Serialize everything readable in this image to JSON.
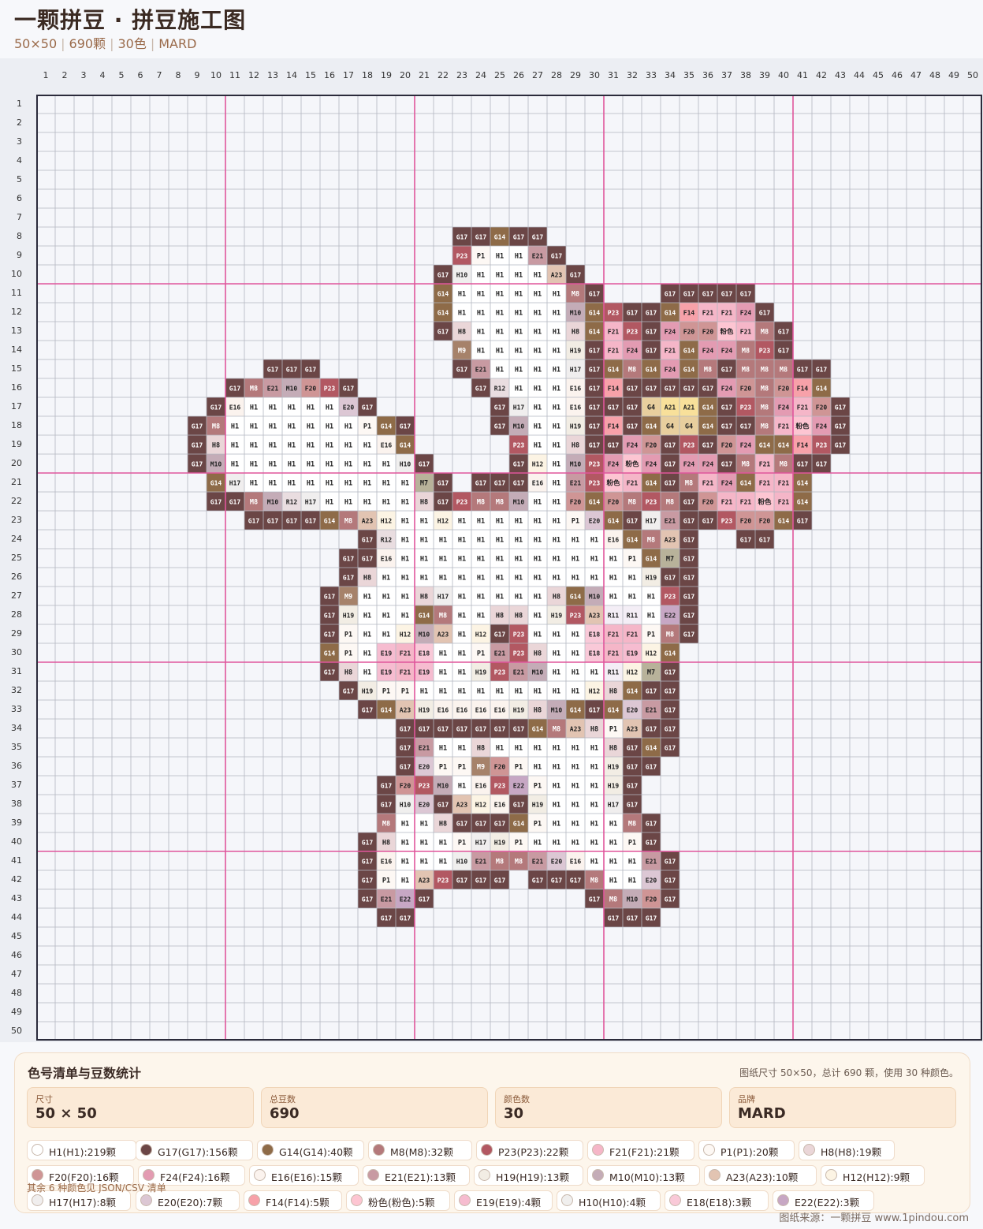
{
  "header": {
    "title": "一颗拼豆 · 拼豆施工图",
    "size": "50×50",
    "count": "690颗",
    "colors": "30色",
    "brand": "MARD"
  },
  "grid": {
    "cols": 50,
    "rows": 50,
    "major_every": 10,
    "line_color": "#b3b7c0",
    "major_color": "#e0569c",
    "border_color": "#2b2b3b",
    "background": "#f5f6fa"
  },
  "palette": {
    "G17": "#6b4646",
    "G14": "#8e6b48",
    "H1": "#ffffff",
    "P23": "#b25862",
    "P1": "#fdf8f4",
    "E21": "#c89aa2",
    "H10": "#f0efee",
    "A23": "#e2c4b2",
    "M8": "#b4797b",
    "M10": "#c4acb7",
    "H8": "#ead6d8",
    "H19": "#f2ede4",
    "M9": "#a6826a",
    "H17": "#f0eeee",
    "R12": "#e9dde0",
    "E16": "#fbf3ee",
    "E20": "#dcc7d4",
    "F20": "#cf9595",
    "F14": "#f7a1a9",
    "F21": "#f5b6c8",
    "F24": "#e39bb2",
    "G4": "#e8cf9e",
    "A21": "#f8e09a",
    "粉色": "#fdc5d2",
    "M7": "#b8b29a",
    "H12": "#fcf4e4",
    "E18": "#f9c9d8",
    "R11": "#f4eef6",
    "E19": "#f6bcd0",
    "E22": "#c7a7c4"
  },
  "rows_data": [
    {
      "r": 8,
      "c": 23,
      "codes": [
        "G17",
        "G17",
        "G14",
        "G17",
        "G17"
      ]
    },
    {
      "r": 9,
      "c": 23,
      "codes": [
        "P23",
        "P1",
        "H1",
        "H1",
        "E21",
        "G17"
      ]
    },
    {
      "r": 10,
      "c": 22,
      "codes": [
        "G17",
        "H10",
        "H1",
        "H1",
        "H1",
        "H1",
        "A23",
        "G17"
      ]
    },
    {
      "r": 11,
      "c": 22,
      "codes": [
        "G14",
        "H1",
        "H1",
        "H1",
        "H1",
        "H1",
        "H1",
        "M8",
        "G17"
      ]
    },
    {
      "r": 11,
      "c": 34,
      "codes": [
        "G17",
        "G17",
        "G17",
        "G17",
        "G17"
      ]
    },
    {
      "r": 12,
      "c": 22,
      "codes": [
        "G14",
        "H1",
        "H1",
        "H1",
        "H1",
        "H1",
        "H1",
        "M10",
        "G14",
        "P23",
        "G17",
        "G17",
        "G14",
        "F14",
        "F21",
        "F21",
        "F24",
        "G17"
      ]
    },
    {
      "r": 13,
      "c": 22,
      "codes": [
        "G17",
        "H8",
        "H1",
        "H1",
        "H1",
        "H1",
        "H1",
        "H8",
        "G14",
        "F21",
        "P23",
        "G17",
        "F24",
        "F20",
        "F20",
        "粉色",
        "F21",
        "M8",
        "G17"
      ]
    },
    {
      "r": 14,
      "c": 23,
      "codes": [
        "M9",
        "H1",
        "H1",
        "H1",
        "H1",
        "H1",
        "H19",
        "G17",
        "F21",
        "F24",
        "G17",
        "F21",
        "G14",
        "F24",
        "F24",
        "M8",
        "P23",
        "G17"
      ]
    },
    {
      "r": 15,
      "c": 13,
      "codes": [
        "G17",
        "G17",
        "G17"
      ]
    },
    {
      "r": 15,
      "c": 23,
      "codes": [
        "G17",
        "E21",
        "H1",
        "H1",
        "H1",
        "H1",
        "H17",
        "G17",
        "G14",
        "M8",
        "G14",
        "F24",
        "G14",
        "M8",
        "G17",
        "M8",
        "M8",
        "M8",
        "G17",
        "G17"
      ]
    },
    {
      "r": 16,
      "c": 11,
      "codes": [
        "G17",
        "M8",
        "E21",
        "M10",
        "F20",
        "P23",
        "G17"
      ]
    },
    {
      "r": 16,
      "c": 24,
      "codes": [
        "G17",
        "R12",
        "H1",
        "H1",
        "H1",
        "E16",
        "G17",
        "F14",
        "G17",
        "G17",
        "G17",
        "G17",
        "G17",
        "F24",
        "F20",
        "M8",
        "F20",
        "F14",
        "G14"
      ]
    },
    {
      "r": 17,
      "c": 10,
      "codes": [
        "G17",
        "E16",
        "H1",
        "H1",
        "H1",
        "H1",
        "H1",
        "E20",
        "G17"
      ]
    },
    {
      "r": 17,
      "c": 25,
      "codes": [
        "G17",
        "H17",
        "H1",
        "H1",
        "E16",
        "G17",
        "G17",
        "G17",
        "G4",
        "A21",
        "A21",
        "G14",
        "G17",
        "P23",
        "M8",
        "F24",
        "F21",
        "F20",
        "G17"
      ]
    },
    {
      "r": 18,
      "c": 9,
      "codes": [
        "G17",
        "M8",
        "H1",
        "H1",
        "H1",
        "H1",
        "H1",
        "H1",
        "H1",
        "P1",
        "G14",
        "G17"
      ]
    },
    {
      "r": 18,
      "c": 25,
      "codes": [
        "G17",
        "M10",
        "H1",
        "H1",
        "H19",
        "G17",
        "F14",
        "G17",
        "G14",
        "G4",
        "G4",
        "G14",
        "G17",
        "G17",
        "M8",
        "F21",
        "粉色",
        "F24",
        "G17"
      ]
    },
    {
      "r": 19,
      "c": 9,
      "codes": [
        "G17",
        "H8",
        "H1",
        "H1",
        "H1",
        "H1",
        "H1",
        "H1",
        "H1",
        "H1",
        "E16",
        "G14"
      ]
    },
    {
      "r": 19,
      "c": 26,
      "codes": [
        "P23",
        "H1",
        "H1",
        "H8",
        "G17",
        "G17",
        "F24",
        "F20",
        "G17",
        "P23",
        "G17",
        "F20",
        "F24",
        "G14",
        "G14",
        "F14",
        "P23",
        "G17"
      ]
    },
    {
      "r": 20,
      "c": 9,
      "codes": [
        "G17",
        "M10",
        "H1",
        "H1",
        "H1",
        "H1",
        "H1",
        "H1",
        "H1",
        "H1",
        "H1",
        "H10",
        "G17"
      ]
    },
    {
      "r": 20,
      "c": 26,
      "codes": [
        "G17",
        "H12",
        "H1",
        "M10",
        "P23",
        "F24",
        "粉色",
        "F24",
        "G17",
        "F24",
        "F24",
        "G17",
        "M8",
        "F21",
        "M8",
        "G17",
        "G17"
      ]
    },
    {
      "r": 21,
      "c": 10,
      "codes": [
        "G14",
        "H17",
        "H1",
        "H1",
        "H1",
        "H1",
        "H1",
        "H1",
        "H1",
        "H1",
        "H1",
        "M7",
        "G17"
      ]
    },
    {
      "r": 21,
      "c": 24,
      "codes": [
        "G17",
        "G17",
        "G17",
        "E16",
        "H1",
        "E21",
        "P23",
        "粉色",
        "F21",
        "G14",
        "G17",
        "M8",
        "F21",
        "F24",
        "G14",
        "F21",
        "F21",
        "G14"
      ]
    },
    {
      "r": 22,
      "c": 10,
      "codes": [
        "G17",
        "G17",
        "M8",
        "M10",
        "R12",
        "H17",
        "H1",
        "H1",
        "H1",
        "H1",
        "H1",
        "H8",
        "G17",
        "P23",
        "M8",
        "M8",
        "M10",
        "H1",
        "H1",
        "F20",
        "G14",
        "F20",
        "M8",
        "P23",
        "M8",
        "G17",
        "F20",
        "F21",
        "F21",
        "粉色",
        "F21",
        "G14"
      ]
    },
    {
      "r": 23,
      "c": 12,
      "codes": [
        "G17",
        "G17",
        "G17",
        "G17",
        "G14",
        "M8",
        "A23",
        "H12",
        "H1",
        "H1",
        "H12",
        "H1",
        "H1",
        "H1",
        "H1",
        "H1",
        "H1",
        "P1",
        "E20",
        "G14",
        "G17",
        "H17",
        "E21",
        "G17",
        "G17",
        "P23",
        "F20",
        "F20",
        "G14",
        "G17"
      ]
    },
    {
      "r": 24,
      "c": 18,
      "codes": [
        "G17",
        "R12",
        "H1",
        "H1",
        "H1",
        "H1",
        "H1",
        "H1",
        "H1",
        "H1",
        "H1",
        "H1",
        "H1",
        "E16",
        "G14",
        "M8",
        "A23",
        "G17"
      ]
    },
    {
      "r": 24,
      "c": 38,
      "codes": [
        "G17",
        "G17"
      ]
    },
    {
      "r": 25,
      "c": 17,
      "codes": [
        "G17",
        "G17",
        "E16",
        "H1",
        "H1",
        "H1",
        "H1",
        "H1",
        "H1",
        "H1",
        "H1",
        "H1",
        "H1",
        "H1",
        "H1",
        "P1",
        "G14",
        "M7",
        "G17"
      ]
    },
    {
      "r": 26,
      "c": 17,
      "codes": [
        "G17",
        "H8",
        "H1",
        "H1",
        "H1",
        "H1",
        "H1",
        "H1",
        "H1",
        "H1",
        "H1",
        "H1",
        "H1",
        "H1",
        "H1",
        "H1",
        "H19",
        "G17",
        "G17"
      ]
    },
    {
      "r": 27,
      "c": 16,
      "codes": [
        "G17",
        "M9",
        "H1",
        "H1",
        "H1",
        "H8",
        "H17",
        "H1",
        "H1",
        "H1",
        "H1",
        "H1",
        "H8",
        "G14",
        "M10",
        "H1",
        "H1",
        "H1",
        "P23",
        "G17"
      ]
    },
    {
      "r": 28,
      "c": 16,
      "codes": [
        "G17",
        "H19",
        "H1",
        "H1",
        "H1",
        "G14",
        "M8",
        "H1",
        "H1",
        "H8",
        "H8",
        "H1",
        "H19",
        "P23",
        "A23",
        "R11",
        "R11",
        "H1",
        "E22",
        "G17"
      ]
    },
    {
      "r": 29,
      "c": 16,
      "codes": [
        "G17",
        "P1",
        "H1",
        "H1",
        "H12",
        "M10",
        "A23",
        "H1",
        "H12",
        "G17",
        "P23",
        "H1",
        "H1",
        "H1",
        "E18",
        "F21",
        "F21",
        "P1",
        "M8",
        "G17"
      ]
    },
    {
      "r": 30,
      "c": 16,
      "codes": [
        "G14",
        "P1",
        "H1",
        "E19",
        "F21",
        "E18",
        "H1",
        "H1",
        "P1",
        "E21",
        "P23",
        "H8",
        "H1",
        "H1",
        "E18",
        "F21",
        "E19",
        "H12",
        "G14"
      ]
    },
    {
      "r": 31,
      "c": 16,
      "codes": [
        "G17",
        "H8",
        "H1",
        "E19",
        "F21",
        "E19",
        "H1",
        "H1",
        "H19",
        "P23",
        "E21",
        "M10",
        "H1",
        "H1",
        "H1",
        "R11",
        "H12",
        "M7",
        "G17"
      ]
    },
    {
      "r": 32,
      "c": 17,
      "codes": [
        "G17",
        "H19",
        "P1",
        "P1",
        "H1",
        "H1",
        "H1",
        "H1",
        "H1",
        "H1",
        "H1",
        "H1",
        "H1",
        "H12",
        "H8",
        "G14",
        "G17",
        "G17"
      ]
    },
    {
      "r": 33,
      "c": 18,
      "codes": [
        "G17",
        "G14",
        "A23",
        "H19",
        "E16",
        "E16",
        "E16",
        "E16",
        "H19",
        "H8",
        "M10",
        "G14",
        "G17",
        "G14",
        "E20",
        "E21",
        "G17"
      ]
    },
    {
      "r": 34,
      "c": 20,
      "codes": [
        "G17",
        "G17",
        "G17",
        "G17",
        "G17",
        "G17",
        "G17",
        "G14",
        "M8",
        "A23",
        "H8",
        "P1",
        "A23",
        "G17",
        "G17"
      ]
    },
    {
      "r": 35,
      "c": 20,
      "codes": [
        "G17",
        "E21",
        "H1",
        "H1",
        "H8",
        "H1",
        "H1",
        "H1",
        "H1",
        "H1",
        "H1",
        "H8",
        "G17",
        "G14",
        "G17"
      ]
    },
    {
      "r": 36,
      "c": 20,
      "codes": [
        "G17",
        "E20",
        "P1",
        "P1",
        "M9",
        "F20",
        "P1",
        "H1",
        "H1",
        "H1",
        "H1",
        "H19",
        "G17",
        "G17"
      ]
    },
    {
      "r": 37,
      "c": 19,
      "codes": [
        "G17",
        "F20",
        "P23",
        "M10",
        "H1",
        "E16",
        "P23",
        "E22",
        "P1",
        "H1",
        "H1",
        "H1",
        "H19",
        "G17"
      ]
    },
    {
      "r": 38,
      "c": 19,
      "codes": [
        "G17",
        "H10",
        "E20",
        "G17",
        "A23",
        "H12",
        "E16",
        "G17",
        "H19",
        "H1",
        "H1",
        "H1",
        "H17",
        "G17"
      ]
    },
    {
      "r": 39,
      "c": 19,
      "codes": [
        "M8",
        "H1",
        "H1",
        "H8",
        "G17",
        "G17",
        "G17",
        "G14",
        "P1",
        "H1",
        "H1",
        "H1",
        "H1",
        "M8",
        "G17"
      ]
    },
    {
      "r": 40,
      "c": 18,
      "codes": [
        "G17",
        "H8",
        "H1",
        "H1",
        "H1",
        "P1",
        "H17",
        "H19",
        "P1",
        "H1",
        "H1",
        "H1",
        "H1",
        "H1",
        "P1",
        "G17"
      ]
    },
    {
      "r": 41,
      "c": 18,
      "codes": [
        "G17",
        "E16",
        "H1",
        "H1",
        "H1",
        "H10",
        "E21",
        "M8",
        "M8",
        "E21",
        "E20",
        "E16",
        "H1",
        "H1",
        "H1",
        "E21",
        "G17"
      ]
    },
    {
      "r": 42,
      "c": 18,
      "codes": [
        "G17",
        "P1",
        "H1",
        "A23",
        "P23",
        "G17",
        "G17",
        "G17"
      ]
    },
    {
      "r": 42,
      "c": 27,
      "codes": [
        "G17",
        "G17",
        "G17",
        "M8",
        "H1",
        "H1",
        "E20",
        "G17"
      ]
    },
    {
      "r": 43,
      "c": 18,
      "codes": [
        "G17",
        "E21",
        "E22",
        "G17"
      ]
    },
    {
      "r": 43,
      "c": 30,
      "codes": [
        "G17",
        "M8",
        "M10",
        "F20",
        "G17"
      ]
    },
    {
      "r": 44,
      "c": 19,
      "codes": [
        "G17",
        "G17"
      ]
    },
    {
      "r": 44,
      "c": 31,
      "codes": [
        "G17",
        "G17",
        "G17"
      ]
    }
  ],
  "panel": {
    "title": "色号清单与豆数统计",
    "summary": "图纸尺寸 50×50，总计 690 颗，使用 30 种颜色。",
    "stats": [
      {
        "label": "尺寸",
        "value": "50 × 50"
      },
      {
        "label": "总豆数",
        "value": "690"
      },
      {
        "label": "颜色数",
        "value": "30"
      },
      {
        "label": "品牌",
        "value": "MARD"
      }
    ],
    "chips": [
      {
        "label": "H1(H1):219颗",
        "color": "#ffffff"
      },
      {
        "label": "G17(G17):156颗",
        "color": "#6b4646"
      },
      {
        "label": "G14(G14):40颗",
        "color": "#8e6b48"
      },
      {
        "label": "M8(M8):32颗",
        "color": "#b4797b"
      },
      {
        "label": "P23(P23):22颗",
        "color": "#b25862"
      },
      {
        "label": "F21(F21):21颗",
        "color": "#f5b6c8"
      },
      {
        "label": "P1(P1):20颗",
        "color": "#fdf8f4"
      },
      {
        "label": "H8(H8):19颗",
        "color": "#ead6d8"
      },
      {
        "label": "F20(F20):16颗",
        "color": "#cf9595"
      },
      {
        "label": "F24(F24):16颗",
        "color": "#e39bb2"
      },
      {
        "label": "E16(E16):15颗",
        "color": "#fbf3ee"
      },
      {
        "label": "E21(E21):13颗",
        "color": "#c89aa2"
      },
      {
        "label": "H19(H19):13颗",
        "color": "#f2ede4"
      },
      {
        "label": "M10(M10):13颗",
        "color": "#c4acb7"
      },
      {
        "label": "A23(A23):10颗",
        "color": "#e2c4b2"
      },
      {
        "label": "H12(H12):9颗",
        "color": "#fcf4e4"
      },
      {
        "label": "H17(H17):8颗",
        "color": "#f0eeee"
      },
      {
        "label": "E20(E20):7颗",
        "color": "#dcc7d4"
      },
      {
        "label": "F14(F14):5颗",
        "color": "#f7a1a9"
      },
      {
        "label": "粉色(粉色):5颗",
        "color": "#fdc5d2"
      },
      {
        "label": "E19(E19):4颗",
        "color": "#f6bcd0"
      },
      {
        "label": "H10(H10):4颗",
        "color": "#f0efee"
      },
      {
        "label": "E18(E18):3颗",
        "color": "#f9c9d8"
      },
      {
        "label": "E22(E22):3颗",
        "color": "#c7a7c4"
      }
    ],
    "note": "其余 6 种颜色见 JSON/CSV 清单"
  },
  "footer": "图纸来源：一颗拼豆 www.1pindou.com"
}
